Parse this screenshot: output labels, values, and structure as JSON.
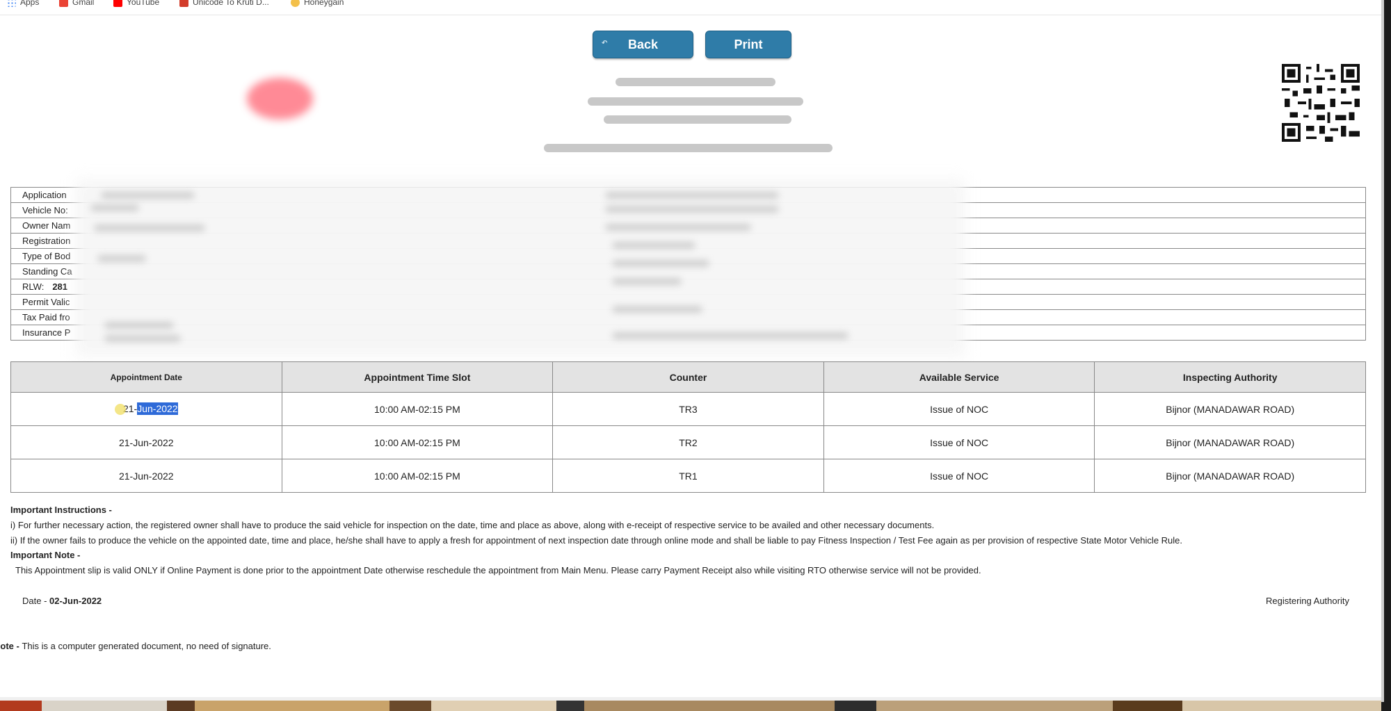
{
  "bookmarks": [
    {
      "label": "Apps",
      "icon": "apps-grid-icon"
    },
    {
      "label": "Gmail",
      "icon": "gmail-icon"
    },
    {
      "label": "YouTube",
      "icon": "youtube-icon"
    },
    {
      "label": "Unicode To Kruti D...",
      "icon": "unicode-icon"
    },
    {
      "label": "Honeygain",
      "icon": "honeygain-icon"
    }
  ],
  "toolbar": {
    "back_label": "Back",
    "print_label": "Print"
  },
  "info": {
    "rows": [
      {
        "label": "Application"
      },
      {
        "label": "Vehicle No:"
      },
      {
        "label": "Owner Nam"
      },
      {
        "label": "Registration"
      },
      {
        "label": "Type of Bod"
      },
      {
        "label": "Standing Ca"
      },
      {
        "label": "RLW:",
        "value": "281"
      },
      {
        "label": "Permit Valic"
      },
      {
        "label": "Tax Paid fro"
      },
      {
        "label": "Insurance P"
      }
    ]
  },
  "appointments": {
    "headers": [
      "Appointment Date",
      "Appointment Time Slot",
      "Counter",
      "Available Service",
      "Inspecting Authority"
    ],
    "rows": [
      {
        "date_prefix": "21-",
        "date_selected": "Jun-2022",
        "time": "10:00 AM-02:15 PM",
        "counter": "TR3",
        "service": "Issue of NOC",
        "authority": "Bijnor (MANADAWAR ROAD)"
      },
      {
        "date": "21-Jun-2022",
        "time": "10:00 AM-02:15 PM",
        "counter": "TR2",
        "service": "Issue of NOC",
        "authority": "Bijnor (MANADAWAR ROAD)"
      },
      {
        "date": "21-Jun-2022",
        "time": "10:00 AM-02:15 PM",
        "counter": "TR1",
        "service": "Issue of NOC",
        "authority": "Bijnor (MANADAWAR ROAD)"
      }
    ]
  },
  "instructions": {
    "heading": "Important Instructions -",
    "line1": "i) For further necessary action, the registered owner shall have to produce the said vehicle for inspection on the date, time and place as above, along with e-receipt of respective service to be availed and other necessary documents.",
    "line2": "ii) If the owner fails to produce the vehicle on the appointed date, time and place, he/she shall have to apply a fresh for appointment of next inspection date through online mode and shall be liable to pay Fitness Inspection / Test Fee again as per provision of respective State Motor Vehicle Rule.",
    "note_heading": "Important Note -",
    "note_text": "This Appointment slip is valid ONLY if Online Payment is done prior to the appointment Date otherwise reschedule the appointment from Main Menu. Please carry Payment Receipt also while visiting RTO otherwise service will not be provided."
  },
  "footer": {
    "date_label": "Date - ",
    "date_value": "02-Jun-2022",
    "authority": "Registering Authority",
    "note_label": "Note - ",
    "note_text": "This is a computer generated document, no need of signature."
  }
}
